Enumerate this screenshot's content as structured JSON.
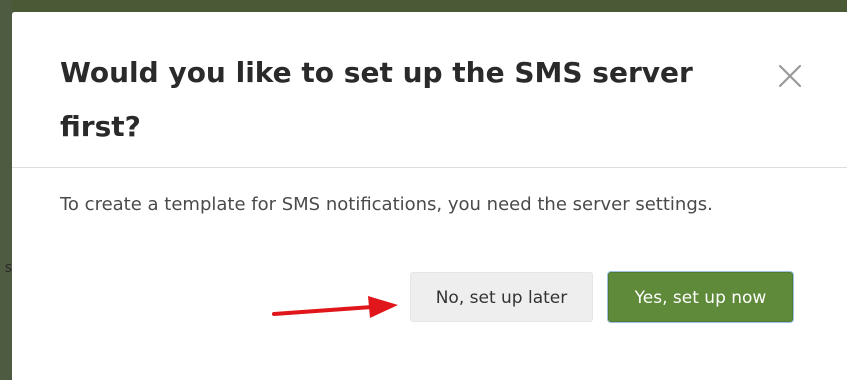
{
  "background": {
    "fragment_text": "s",
    "overlay_color": "#7d7d7d",
    "top_strip_color": "#4a5a36"
  },
  "dialog": {
    "title": "Would you like to set up the SMS server first?",
    "close_icon": "close-icon",
    "message": "To create a template for SMS notifications, you need the server settings.",
    "buttons": {
      "later_label": "No, set up later",
      "now_label": "Yes, set up now"
    }
  },
  "annotation": {
    "arrow_icon": "red-arrow-icon",
    "arrow_color": "#e0161b"
  },
  "colors": {
    "primary_button": "#5e8a3a",
    "secondary_button": "#eeeeee",
    "title_text": "#2a2a2a",
    "body_text": "#4a4a4a"
  }
}
